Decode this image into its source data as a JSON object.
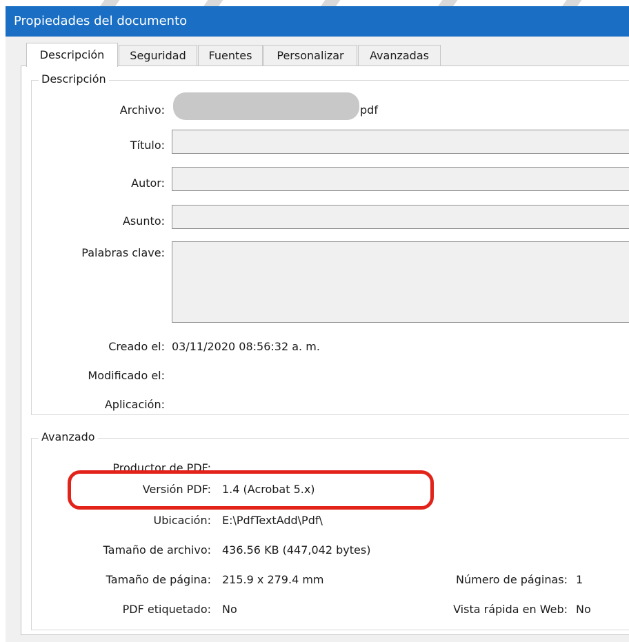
{
  "dialog": {
    "title": "Propiedades del documento"
  },
  "tabs": [
    {
      "label": "Descripción",
      "active": true
    },
    {
      "label": "Seguridad",
      "active": false
    },
    {
      "label": "Fuentes",
      "active": false
    },
    {
      "label": "Personalizar",
      "active": false
    },
    {
      "label": "Avanzadas",
      "active": false
    }
  ],
  "description": {
    "legend": "Descripción",
    "file_label": "Archivo:",
    "file_value": "pdf",
    "title_label": "Título:",
    "title_value": "",
    "author_label": "Autor:",
    "author_value": "",
    "subject_label": "Asunto:",
    "subject_value": "",
    "keywords_label": "Palabras clave:",
    "keywords_value": "",
    "created_label": "Creado el:",
    "created_value": "03/11/2020 08:56:32 a. m.",
    "modified_label": "Modificado el:",
    "modified_value": "",
    "application_label": "Aplicación:",
    "application_value": ""
  },
  "advanced": {
    "legend": "Avanzado",
    "producer_label": "Productor de PDF:",
    "producer_value": "",
    "version_label": "Versión PDF:",
    "version_value": "1.4 (Acrobat 5.x)",
    "location_label": "Ubicación:",
    "location_value": "E:\\PdfTextAdd\\Pdf\\",
    "filesize_label": "Tamaño de archivo:",
    "filesize_value": "436.56 KB (447,042 bytes)",
    "pagesize_label": "Tamaño de página:",
    "pagesize_value": "215.9 x 279.4 mm",
    "pages_label": "Número de páginas:",
    "pages_value": "1",
    "tagged_label": "PDF etiquetado:",
    "tagged_value": "No",
    "fastweb_label": "Vista rápida en Web:",
    "fastweb_value": "No"
  },
  "colors": {
    "titlebar": "#1a6fc4",
    "highlight": "#e2231a",
    "redaction": "#c8c8c8"
  }
}
